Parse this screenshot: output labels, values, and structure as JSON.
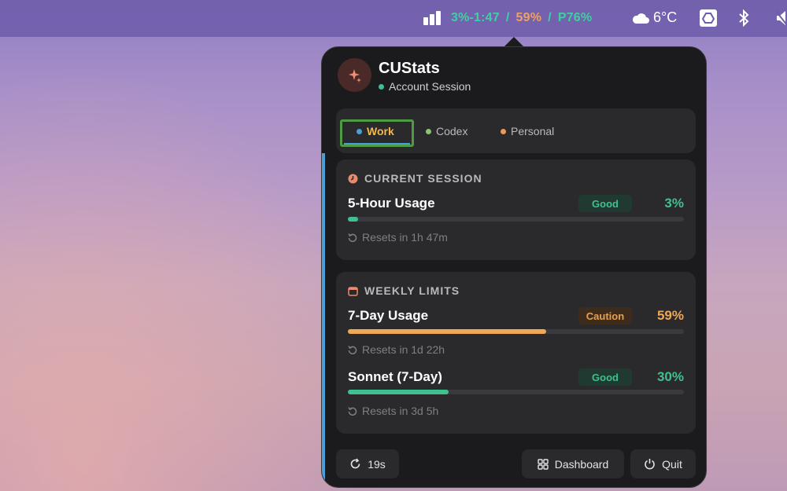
{
  "menubar": {
    "stats": {
      "session": "3%-1:47",
      "sep1": "/",
      "weekly": "59%",
      "sep2": "/",
      "p": "P76%"
    },
    "weather": "6°C",
    "icons": [
      "signal-bars-icon",
      "cloud-icon",
      "drive-icon",
      "bluetooth-icon",
      "mute-icon"
    ]
  },
  "app": {
    "title": "CUStats",
    "subtitle": "Account Session",
    "icon": "sparkle-icon"
  },
  "tabs": [
    {
      "label": "Work",
      "dot_color": "#4b9fd8",
      "active": true
    },
    {
      "label": "Codex",
      "dot_color": "#8bc46a",
      "active": false
    },
    {
      "label": "Personal",
      "dot_color": "#e89a5a",
      "active": false
    }
  ],
  "current_session": {
    "heading": "CURRENT SESSION",
    "metrics": [
      {
        "name": "5-Hour Usage",
        "badge": "Good",
        "percent_text": "3%",
        "percent": 3,
        "reset": "Resets in 1h 47m",
        "color": "#3fc08f"
      }
    ]
  },
  "weekly_limits": {
    "heading": "WEEKLY LIMITS",
    "metrics": [
      {
        "name": "7-Day Usage",
        "badge": "Caution",
        "percent_text": "59%",
        "percent": 59,
        "reset": "Resets in 1d 22h",
        "color": "#f0a855"
      },
      {
        "name": "Sonnet (7-Day)",
        "badge": "Good",
        "percent_text": "30%",
        "percent": 30,
        "reset": "Resets in 3d 5h",
        "color": "#3fc08f"
      }
    ]
  },
  "footer": {
    "refresh": "19s",
    "dashboard": "Dashboard",
    "quit": "Quit"
  },
  "colors": {
    "good": "#3fc08f",
    "caution": "#f0a855",
    "accent": "#4b9fd8"
  }
}
